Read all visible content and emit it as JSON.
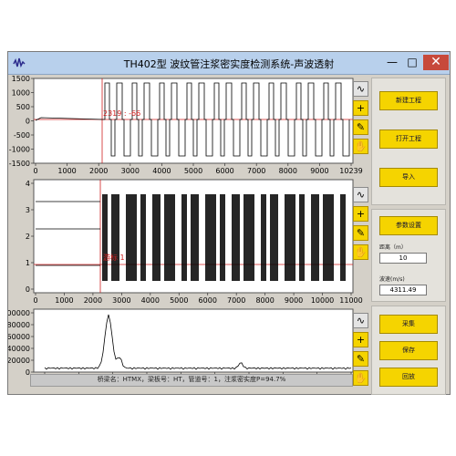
{
  "window": {
    "title": "TH402型 波纹管注浆密实度检测系统-声波透射",
    "app_icon": "waveform-app-icon",
    "minimize": "—",
    "maximize": "□",
    "close": "✕"
  },
  "plot1": {
    "x_ticks": [
      "0",
      "1000",
      "2000",
      "3000",
      "4000",
      "5000",
      "6000",
      "7000",
      "8000",
      "9000",
      "10239"
    ],
    "y_ticks": [
      "1500",
      "1000",
      "500",
      "0",
      "-500",
      "-1000",
      "-1500"
    ],
    "cursor_label": "2319 : -66"
  },
  "plot2": {
    "x_ticks": [
      "0",
      "1000",
      "2000",
      "3000",
      "4000",
      "5000",
      "6000",
      "7000",
      "8000",
      "9000",
      "10000",
      "11000"
    ],
    "y_ticks": [
      "4",
      "3",
      "2",
      "1",
      "0"
    ],
    "cursor_label": "游标 1"
  },
  "plot3": {
    "x_ticks": [
      "1000",
      "2000",
      "3000",
      "4000",
      "5000",
      "6000",
      "7000",
      "8000",
      "9000",
      "10000"
    ],
    "y_ticks": [
      "100000",
      "80000",
      "60000",
      "40000",
      "20000",
      "0"
    ]
  },
  "tool_icons": [
    "plot-shape-icon",
    "cursor-cross-icon",
    "zoom-icon",
    "pan-hand-icon"
  ],
  "tool_glyphs": [
    "∿",
    "+",
    "✎",
    "✋"
  ],
  "status": "桥梁名：HTMX，梁板号：HT，管道号：1，注浆密实度P=94.7%",
  "right_panel": {
    "new_project": "新建工程",
    "open_project": "打开工程",
    "import": "导入",
    "param_settings": "参数设置",
    "distance_label": "距离（m）",
    "distance_value": "10",
    "velocity_label": "波速(m/s)",
    "velocity_value": "4311.49",
    "collect": "采集",
    "save": "保存",
    "back": "回放"
  },
  "colors": {
    "accent_yellow": "#f5d400",
    "cursor_red": "#d02020",
    "title_bar": "#b8d0ec",
    "panel": "#d4d0c8"
  }
}
